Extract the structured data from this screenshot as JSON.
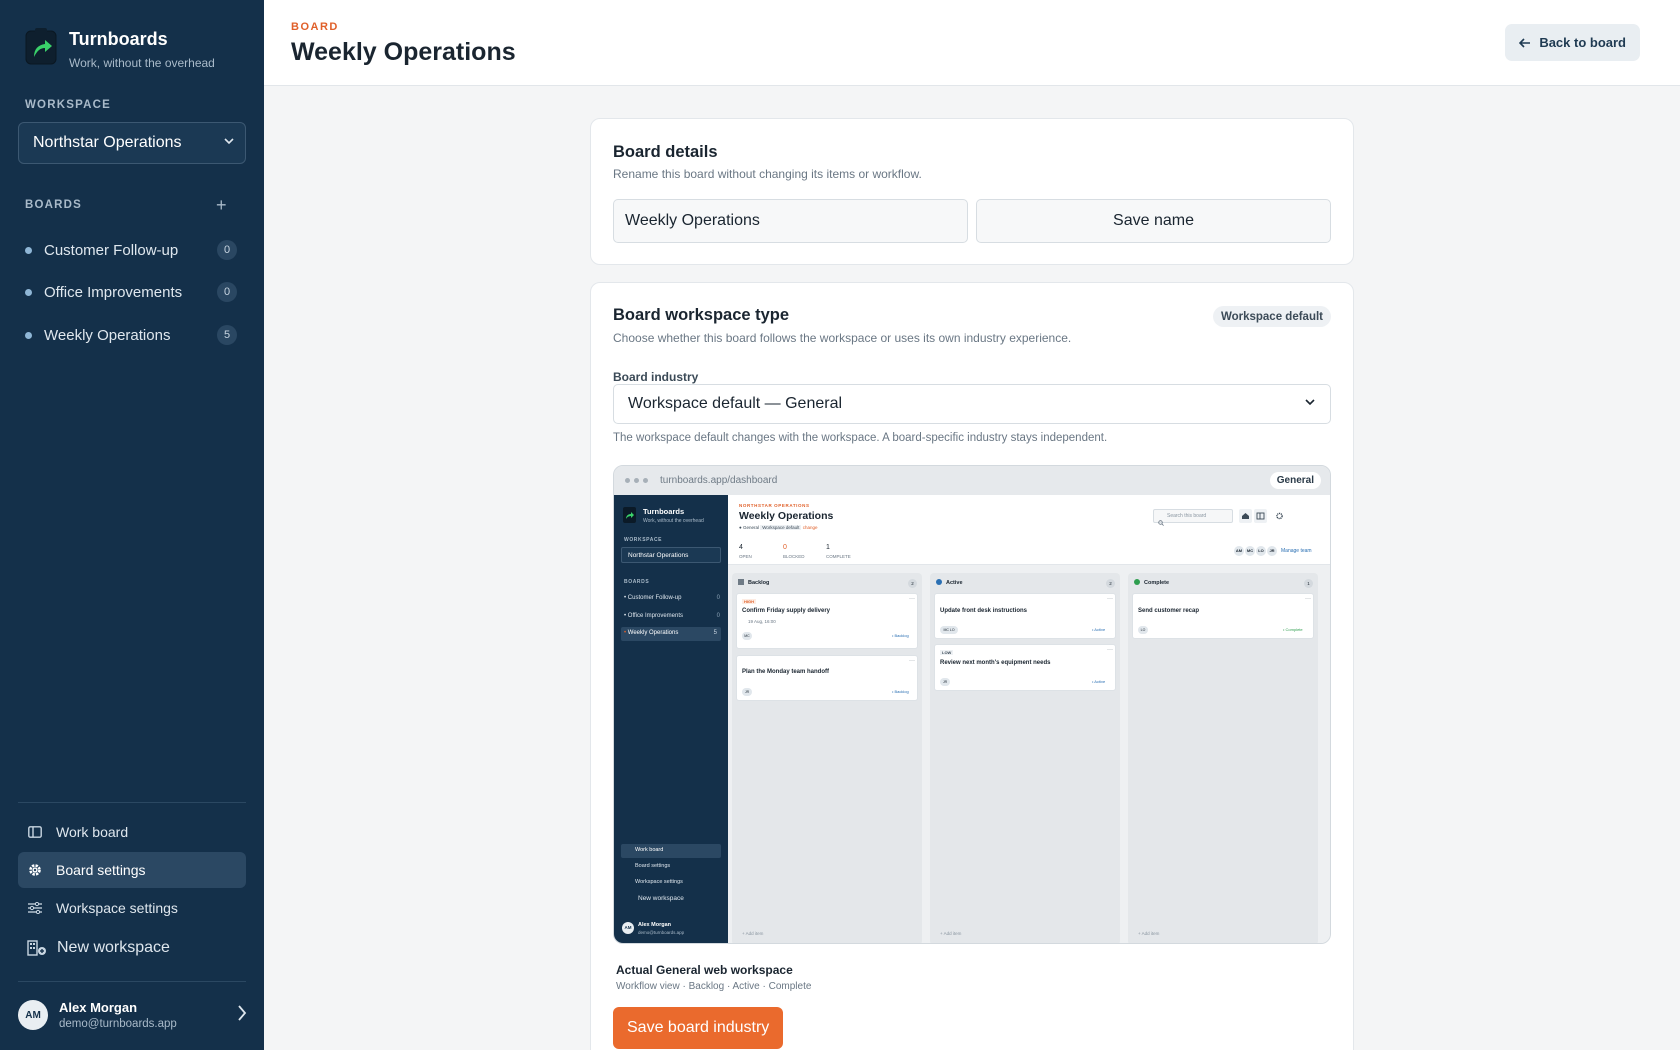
{
  "brand": {
    "name": "Turnboards",
    "tagline": "Work, without the overhead"
  },
  "sidebar": {
    "workspace_label": "WORKSPACE",
    "workspace_value": "Northstar Operations",
    "boards_label": "BOARDS",
    "add_board_symbol": "+",
    "boards": [
      {
        "name": "Customer Follow-up",
        "count": "0"
      },
      {
        "name": "Office Improvements",
        "count": "0"
      },
      {
        "name": "Weekly Operations",
        "count": "5"
      }
    ],
    "nav": [
      {
        "label": "Work board",
        "icon": "board-icon",
        "active": false
      },
      {
        "label": "Board settings",
        "icon": "gear-icon",
        "active": true
      },
      {
        "label": "Workspace settings",
        "icon": "sliders-icon",
        "active": false
      },
      {
        "label": "New workspace",
        "icon": "building-plus-icon",
        "active": false
      }
    ],
    "user": {
      "initials": "AM",
      "name": "Alex Morgan",
      "email": "demo@turnboards.app"
    }
  },
  "header": {
    "kicker": "BOARD",
    "title": "Weekly Operations",
    "back_label": "Back to board"
  },
  "board_details": {
    "title": "Board details",
    "description": "Rename this board without changing its items or workflow.",
    "name_value": "Weekly Operations",
    "save_label": "Save name"
  },
  "workspace_type": {
    "title": "Board workspace type",
    "badge": "Workspace default",
    "description": "Choose whether this board follows the workspace or uses its own industry experience.",
    "field_label": "Board industry",
    "select_value": "Workspace default — General",
    "hint": "The workspace default changes with the workspace. A board-specific industry stays independent.",
    "caption_title": "Actual General web workspace",
    "caption_sub": "Workflow view · Backlog · Active · Complete",
    "save_label": "Save board industry"
  },
  "preview": {
    "url": "turnboards.app/dashboard",
    "tag": "General",
    "brand": "Turnboards",
    "tagline": "Work, without the overhead",
    "workspace_label": "WORKSPACE",
    "workspace_value": "Northstar Operations",
    "boards_label": "BOARDS",
    "boards": [
      {
        "name": "Customer Follow-up",
        "count": "0"
      },
      {
        "name": "Office Improvements",
        "count": "0"
      },
      {
        "name": "Weekly Operations",
        "count": "5"
      }
    ],
    "nav": [
      "Work board",
      "Board settings",
      "Workspace settings",
      "New workspace"
    ],
    "user_initials": "AM",
    "user_name": "Alex Morgan",
    "user_email": "demo@turnboards.app",
    "kicker": "NORTHSTAR OPERATIONS",
    "title": "Weekly Operations",
    "meta": [
      "General",
      "Workspace default",
      "change"
    ],
    "search_placeholder": "Search this board",
    "stats": [
      {
        "value": "4",
        "label": "OPEN"
      },
      {
        "value": "0",
        "label": "BLOCKED"
      },
      {
        "value": "1",
        "label": "COMPLETE"
      }
    ],
    "team_initials": [
      "AM",
      "MC",
      "LO",
      "JR"
    ],
    "manage_team": "Manage team",
    "columns": [
      {
        "name": "Backlog",
        "count": "2",
        "add": "+ Add item",
        "cards": [
          {
            "tag": "HIGH",
            "title": "Confirm Friday supply delivery",
            "date": "19 Aug, 16:00",
            "assignee": "MC",
            "status": "Backlog"
          },
          {
            "tag": "",
            "title": "Plan the Monday team handoff",
            "date": "",
            "assignee": "JR",
            "status": "Backlog"
          }
        ]
      },
      {
        "name": "Active",
        "count": "2",
        "add": "+ Add item",
        "cards": [
          {
            "tag": "",
            "title": "Update front desk instructions",
            "date": "",
            "assignee": "MC LO",
            "status": "Active"
          },
          {
            "tag": "LOW",
            "title": "Review next month's equipment needs",
            "date": "",
            "assignee": "JR",
            "status": "Active"
          }
        ]
      },
      {
        "name": "Complete",
        "count": "1",
        "add": "+ Add item",
        "cards": [
          {
            "tag": "",
            "title": "Send customer recap",
            "date": "",
            "assignee": "LO",
            "status": "Complete"
          }
        ]
      }
    ]
  }
}
